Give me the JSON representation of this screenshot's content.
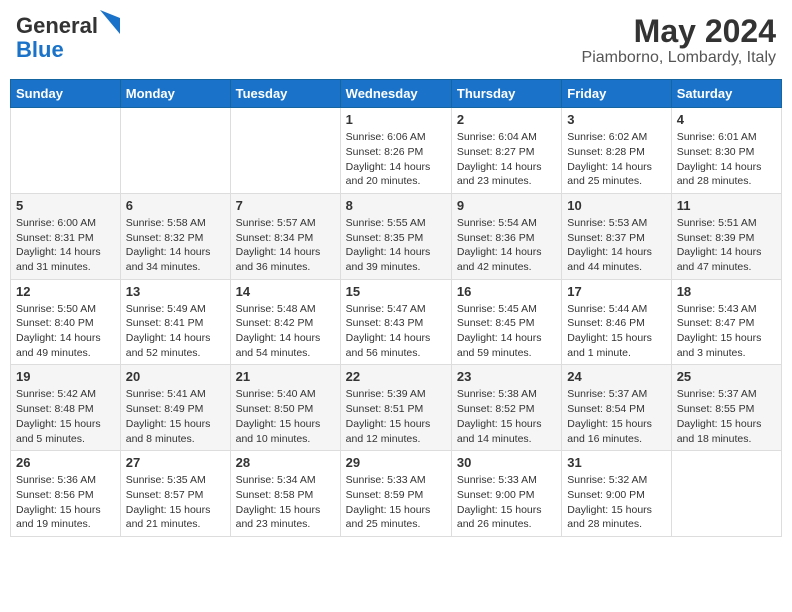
{
  "logo": {
    "text_general": "General",
    "text_blue": "Blue"
  },
  "title": {
    "month_year": "May 2024",
    "location": "Piamborno, Lombardy, Italy"
  },
  "headers": [
    "Sunday",
    "Monday",
    "Tuesday",
    "Wednesday",
    "Thursday",
    "Friday",
    "Saturday"
  ],
  "weeks": [
    [
      {
        "day": "",
        "sunrise": "",
        "sunset": "",
        "daylight": ""
      },
      {
        "day": "",
        "sunrise": "",
        "sunset": "",
        "daylight": ""
      },
      {
        "day": "",
        "sunrise": "",
        "sunset": "",
        "daylight": ""
      },
      {
        "day": "1",
        "sunrise": "Sunrise: 6:06 AM",
        "sunset": "Sunset: 8:26 PM",
        "daylight": "Daylight: 14 hours and 20 minutes."
      },
      {
        "day": "2",
        "sunrise": "Sunrise: 6:04 AM",
        "sunset": "Sunset: 8:27 PM",
        "daylight": "Daylight: 14 hours and 23 minutes."
      },
      {
        "day": "3",
        "sunrise": "Sunrise: 6:02 AM",
        "sunset": "Sunset: 8:28 PM",
        "daylight": "Daylight: 14 hours and 25 minutes."
      },
      {
        "day": "4",
        "sunrise": "Sunrise: 6:01 AM",
        "sunset": "Sunset: 8:30 PM",
        "daylight": "Daylight: 14 hours and 28 minutes."
      }
    ],
    [
      {
        "day": "5",
        "sunrise": "Sunrise: 6:00 AM",
        "sunset": "Sunset: 8:31 PM",
        "daylight": "Daylight: 14 hours and 31 minutes."
      },
      {
        "day": "6",
        "sunrise": "Sunrise: 5:58 AM",
        "sunset": "Sunset: 8:32 PM",
        "daylight": "Daylight: 14 hours and 34 minutes."
      },
      {
        "day": "7",
        "sunrise": "Sunrise: 5:57 AM",
        "sunset": "Sunset: 8:34 PM",
        "daylight": "Daylight: 14 hours and 36 minutes."
      },
      {
        "day": "8",
        "sunrise": "Sunrise: 5:55 AM",
        "sunset": "Sunset: 8:35 PM",
        "daylight": "Daylight: 14 hours and 39 minutes."
      },
      {
        "day": "9",
        "sunrise": "Sunrise: 5:54 AM",
        "sunset": "Sunset: 8:36 PM",
        "daylight": "Daylight: 14 hours and 42 minutes."
      },
      {
        "day": "10",
        "sunrise": "Sunrise: 5:53 AM",
        "sunset": "Sunset: 8:37 PM",
        "daylight": "Daylight: 14 hours and 44 minutes."
      },
      {
        "day": "11",
        "sunrise": "Sunrise: 5:51 AM",
        "sunset": "Sunset: 8:39 PM",
        "daylight": "Daylight: 14 hours and 47 minutes."
      }
    ],
    [
      {
        "day": "12",
        "sunrise": "Sunrise: 5:50 AM",
        "sunset": "Sunset: 8:40 PM",
        "daylight": "Daylight: 14 hours and 49 minutes."
      },
      {
        "day": "13",
        "sunrise": "Sunrise: 5:49 AM",
        "sunset": "Sunset: 8:41 PM",
        "daylight": "Daylight: 14 hours and 52 minutes."
      },
      {
        "day": "14",
        "sunrise": "Sunrise: 5:48 AM",
        "sunset": "Sunset: 8:42 PM",
        "daylight": "Daylight: 14 hours and 54 minutes."
      },
      {
        "day": "15",
        "sunrise": "Sunrise: 5:47 AM",
        "sunset": "Sunset: 8:43 PM",
        "daylight": "Daylight: 14 hours and 56 minutes."
      },
      {
        "day": "16",
        "sunrise": "Sunrise: 5:45 AM",
        "sunset": "Sunset: 8:45 PM",
        "daylight": "Daylight: 14 hours and 59 minutes."
      },
      {
        "day": "17",
        "sunrise": "Sunrise: 5:44 AM",
        "sunset": "Sunset: 8:46 PM",
        "daylight": "Daylight: 15 hours and 1 minute."
      },
      {
        "day": "18",
        "sunrise": "Sunrise: 5:43 AM",
        "sunset": "Sunset: 8:47 PM",
        "daylight": "Daylight: 15 hours and 3 minutes."
      }
    ],
    [
      {
        "day": "19",
        "sunrise": "Sunrise: 5:42 AM",
        "sunset": "Sunset: 8:48 PM",
        "daylight": "Daylight: 15 hours and 5 minutes."
      },
      {
        "day": "20",
        "sunrise": "Sunrise: 5:41 AM",
        "sunset": "Sunset: 8:49 PM",
        "daylight": "Daylight: 15 hours and 8 minutes."
      },
      {
        "day": "21",
        "sunrise": "Sunrise: 5:40 AM",
        "sunset": "Sunset: 8:50 PM",
        "daylight": "Daylight: 15 hours and 10 minutes."
      },
      {
        "day": "22",
        "sunrise": "Sunrise: 5:39 AM",
        "sunset": "Sunset: 8:51 PM",
        "daylight": "Daylight: 15 hours and 12 minutes."
      },
      {
        "day": "23",
        "sunrise": "Sunrise: 5:38 AM",
        "sunset": "Sunset: 8:52 PM",
        "daylight": "Daylight: 15 hours and 14 minutes."
      },
      {
        "day": "24",
        "sunrise": "Sunrise: 5:37 AM",
        "sunset": "Sunset: 8:54 PM",
        "daylight": "Daylight: 15 hours and 16 minutes."
      },
      {
        "day": "25",
        "sunrise": "Sunrise: 5:37 AM",
        "sunset": "Sunset: 8:55 PM",
        "daylight": "Daylight: 15 hours and 18 minutes."
      }
    ],
    [
      {
        "day": "26",
        "sunrise": "Sunrise: 5:36 AM",
        "sunset": "Sunset: 8:56 PM",
        "daylight": "Daylight: 15 hours and 19 minutes."
      },
      {
        "day": "27",
        "sunrise": "Sunrise: 5:35 AM",
        "sunset": "Sunset: 8:57 PM",
        "daylight": "Daylight: 15 hours and 21 minutes."
      },
      {
        "day": "28",
        "sunrise": "Sunrise: 5:34 AM",
        "sunset": "Sunset: 8:58 PM",
        "daylight": "Daylight: 15 hours and 23 minutes."
      },
      {
        "day": "29",
        "sunrise": "Sunrise: 5:33 AM",
        "sunset": "Sunset: 8:59 PM",
        "daylight": "Daylight: 15 hours and 25 minutes."
      },
      {
        "day": "30",
        "sunrise": "Sunrise: 5:33 AM",
        "sunset": "Sunset: 9:00 PM",
        "daylight": "Daylight: 15 hours and 26 minutes."
      },
      {
        "day": "31",
        "sunrise": "Sunrise: 5:32 AM",
        "sunset": "Sunset: 9:00 PM",
        "daylight": "Daylight: 15 hours and 28 minutes."
      },
      {
        "day": "",
        "sunrise": "",
        "sunset": "",
        "daylight": ""
      }
    ]
  ]
}
